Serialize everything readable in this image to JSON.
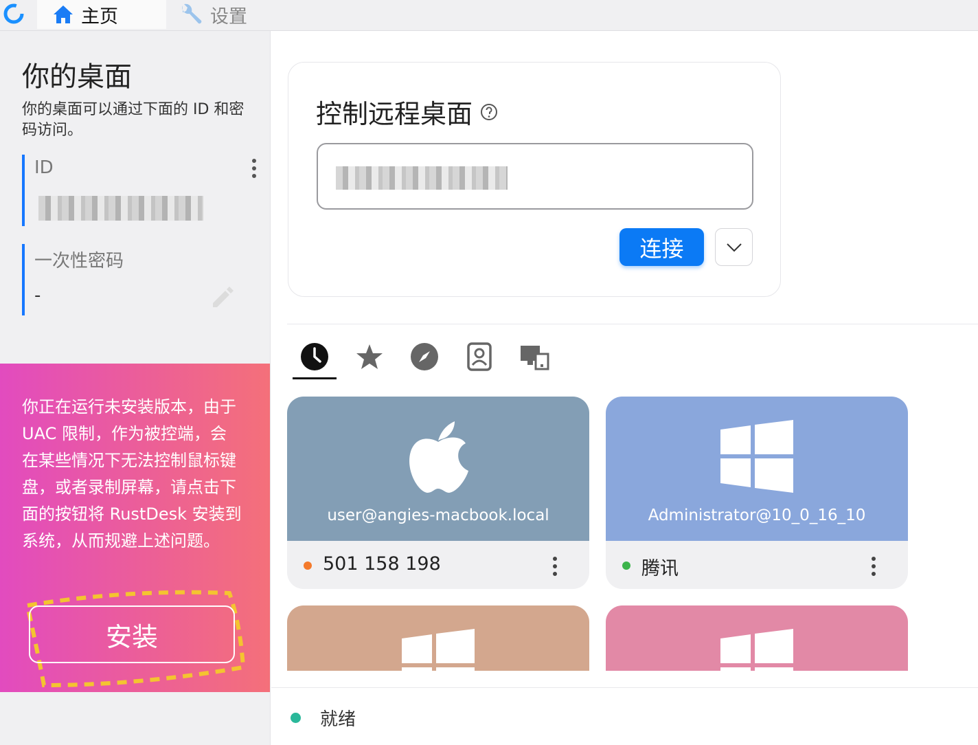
{
  "tabs": {
    "home": "主页",
    "settings": "设置"
  },
  "desktop": {
    "title": "你的桌面",
    "description": "你的桌面可以通过下面的 ID 和密码访问。",
    "id_label": "ID",
    "password_label": "一次性密码",
    "password_value": "-"
  },
  "warning": {
    "text": "你正在运行未安装版本，由于 UAC 限制，作为被控端，会在某些情况下无法控制鼠标键盘，或者录制屏幕，请点击下面的按钮将 RustDesk 安装到系统，从而规避上述问题。",
    "install_label": "安装"
  },
  "remote": {
    "title": "控制远程桌面",
    "connect_label": "连接"
  },
  "peer_tabs": [
    "recent-icon",
    "favorites-icon",
    "discovered-icon",
    "address-book-icon",
    "group-icon"
  ],
  "peers": [
    {
      "user": "user@angies-macbook.local",
      "name": "501 158 198",
      "os": "apple-icon",
      "color": "#839eb5",
      "status_color": "#f47a2c"
    },
    {
      "user": "Administrator@10_0_16_10",
      "name": "腾讯",
      "os": "windows-icon",
      "color": "#8aa7dc",
      "status_color": "#3cb44b"
    },
    {
      "user": "",
      "name": "",
      "os": "windows-icon",
      "color": "#d3a78e",
      "status_color": ""
    },
    {
      "user": "",
      "name": "",
      "os": "windows-icon",
      "color": "#e289a6",
      "status_color": ""
    }
  ],
  "status": {
    "text": "就绪",
    "color": "#2ab89a"
  }
}
